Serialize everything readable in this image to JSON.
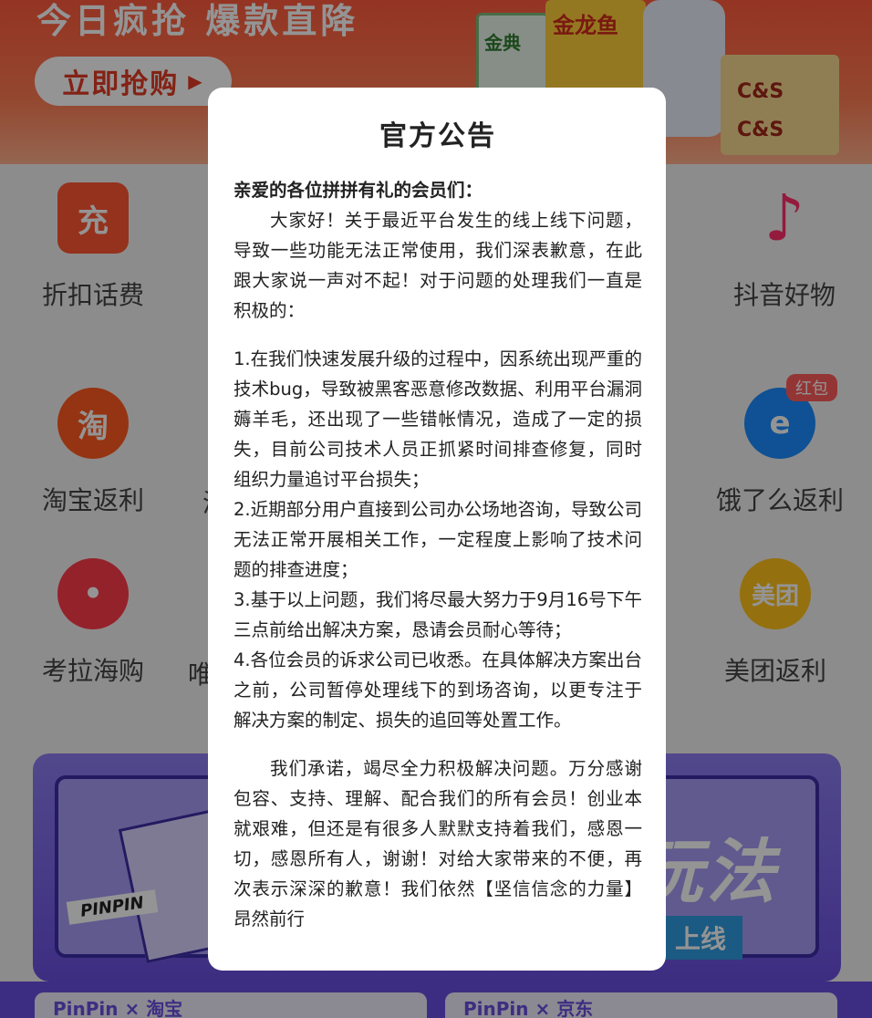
{
  "background": {
    "banner": {
      "headline": "今日疯抢 爆款直降",
      "cta_label": "立即抢购",
      "products": [
        "金典",
        "金龙鱼",
        "C&S",
        "C&S"
      ]
    },
    "grid_items": [
      {
        "label": "折扣话费",
        "icon": "充"
      },
      {
        "label": "抖音好物",
        "icon": "♪"
      },
      {
        "label": "淘宝返利",
        "icon": "淘"
      },
      {
        "label": "饿了么返利",
        "icon": "e"
      },
      {
        "label": "考拉海购",
        "icon": "•"
      },
      {
        "label": "美团返利",
        "icon": "美团"
      }
    ],
    "hongbao_badge": "红包",
    "cut_labels": [
      "淘",
      "唯"
    ],
    "promo": {
      "headline": "新玩法",
      "button": "上线",
      "tag": "PINPIN"
    },
    "bottom_tabs": [
      "PinPin × 淘宝",
      "PinPin × 京东"
    ]
  },
  "announcement": {
    "title": "官方公告",
    "greeting": "亲爱的各位拼拼有礼的会员们：",
    "intro": "大家好！关于最近平台发生的线上线下问题，导致一些功能无法正常使用，我们深表歉意，在此跟大家说一声对不起！对于问题的处理我们一直是积极的：",
    "points": [
      "1.在我们快速发展升级的过程中，因系统出现严重的技术bug，导致被黑客恶意修改数据、利用平台漏洞薅羊毛，还出现了一些错帐情况，造成了一定的损失，目前公司技术人员正抓紧时间排查修复，同时组织力量追讨平台损失；",
      "2.近期部分用户直接到公司办公场地咨询，导致公司无法正常开展相关工作，一定程度上影响了技术问题的排查进度；",
      "3.基于以上问题，我们将尽最大努力于9月16号下午三点前给出解决方案，恳请会员耐心等待；",
      "4.各位会员的诉求公司已收悉。在具体解决方案出台之前，公司暂停处理线下的到场咨询，以更专注于解决方案的制定、损失的追回等处置工作。"
    ],
    "closing": "我们承诺，竭尽全力积极解决问题。万分感谢包容、支持、理解、配合我们的所有会员！创业本就艰难，但还是有很多人默默支持着我们，感恩一切，感恩所有人，谢谢！对给大家带来的不便，再次表示深深的歉意！我们依然【坚信信念的力量】昂然前行"
  },
  "colors": {
    "banner": "#ff5a3d",
    "promo": "#6a4fe0",
    "overlay": "rgba(0,0,0,0.42)",
    "dialog_bg": "#ffffff"
  }
}
